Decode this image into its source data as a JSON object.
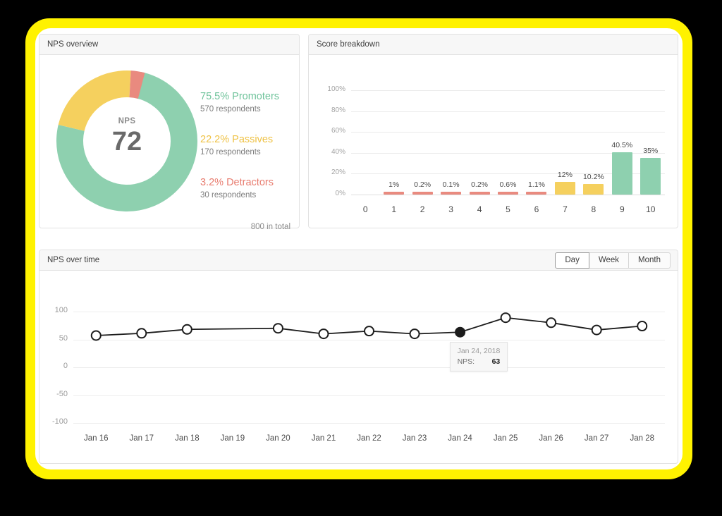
{
  "theme": {
    "promoter_color": "#8ED0AF",
    "passive_color": "#F5D05E",
    "detractor_color": "#E98A7F",
    "highlight_color": "#FFF200",
    "backdrop_color": "#000000"
  },
  "nps_overview": {
    "title": "NPS overview",
    "center_label": "NPS",
    "center_value": "72",
    "total_label": "800 in total",
    "legend": [
      {
        "pct": "75.5% Promoters",
        "sub": "570 respondents",
        "color": "#6FC39B"
      },
      {
        "pct": "22.2% Passives",
        "sub": "170 respondents",
        "color": "#EFC245"
      },
      {
        "pct": "3.2% Detractors",
        "sub": "30 respondents",
        "color": "#E87C6F"
      }
    ],
    "chart_data": {
      "type": "pie",
      "title": "NPS overview",
      "categories": [
        "Promoters",
        "Passives",
        "Detractors"
      ],
      "values": [
        75.5,
        22.2,
        3.2
      ],
      "counts": [
        570,
        170,
        30
      ],
      "total": 800,
      "nps_score": 72,
      "colors": [
        "#8ED0AF",
        "#F5D05E",
        "#E98A7F"
      ],
      "legend": "right",
      "donut": true
    }
  },
  "score_breakdown": {
    "title": "Score breakdown",
    "chart_data": {
      "type": "bar",
      "title": "Score breakdown",
      "xlabel": "",
      "ylabel": "",
      "ylim": [
        0,
        100
      ],
      "yticks": [
        "0%",
        "20%",
        "40%",
        "60%",
        "80%",
        "100%"
      ],
      "ytick_values": [
        0,
        20,
        40,
        60,
        80,
        100
      ],
      "grid": true,
      "categories": [
        "0",
        "1",
        "2",
        "3",
        "4",
        "5",
        "6",
        "7",
        "8",
        "9",
        "10"
      ],
      "values": [
        0,
        1,
        0.2,
        0.1,
        0.2,
        0.6,
        1.1,
        12,
        10.2,
        40.5,
        35
      ],
      "labels": [
        "",
        "1%",
        "0.2%",
        "0.1%",
        "0.2%",
        "0.6%",
        "1.1%",
        "12%",
        "10.2%",
        "40.5%",
        "35%"
      ],
      "bar_colors": [
        "#E98A7F",
        "#E98A7F",
        "#E98A7F",
        "#E98A7F",
        "#E98A7F",
        "#E98A7F",
        "#E98A7F",
        "#F5D05E",
        "#F5D05E",
        "#8ED0AF",
        "#8ED0AF"
      ]
    }
  },
  "nps_over_time": {
    "title": "NPS over time",
    "range_buttons": [
      {
        "label": "Day",
        "active": true
      },
      {
        "label": "Week",
        "active": false
      },
      {
        "label": "Month",
        "active": false
      }
    ],
    "tooltip": {
      "date": "Jan 24, 2018",
      "key": "NPS:",
      "value": "63"
    },
    "chart_data": {
      "type": "line",
      "title": "NPS over time",
      "xlabel": "",
      "ylabel": "",
      "ylim": [
        -100,
        100
      ],
      "yticks": [
        "100",
        "50",
        "0",
        "-50",
        "-100"
      ],
      "ytick_values": [
        100,
        50,
        0,
        -50,
        -100
      ],
      "grid": true,
      "legend": "none",
      "x": [
        "Jan 16",
        "Jan 17",
        "Jan 18",
        "Jan 19",
        "Jan 20",
        "Jan 21",
        "Jan 22",
        "Jan 23",
        "Jan 24",
        "Jan 25",
        "Jan 26",
        "Jan 27",
        "Jan 28"
      ],
      "series": [
        {
          "name": "NPS",
          "values": [
            57,
            61,
            68,
            null,
            70,
            60,
            65,
            60,
            63,
            89,
            80,
            67,
            74
          ],
          "marker_at": [
            true,
            true,
            true,
            false,
            true,
            true,
            true,
            true,
            true,
            true,
            true,
            true,
            true
          ],
          "highlighted_index": 8,
          "color": "#1c1c1c"
        }
      ]
    }
  }
}
